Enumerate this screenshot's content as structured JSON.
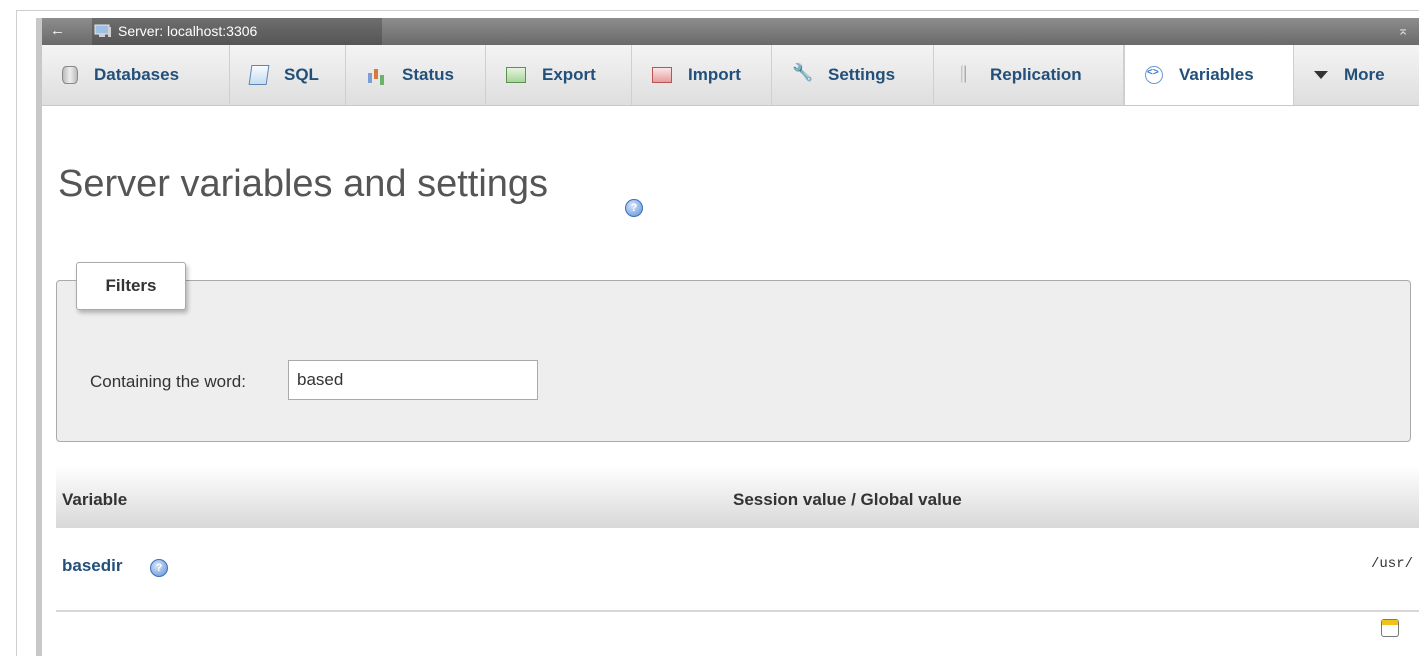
{
  "topbar": {
    "back_glyph": "←",
    "server_label": "Server: localhost:3306",
    "collapse_glyph": "⌅"
  },
  "tabs": [
    {
      "label": "Databases",
      "icon": "database-icon"
    },
    {
      "label": "SQL",
      "icon": "sql-icon"
    },
    {
      "label": "Status",
      "icon": "status-icon"
    },
    {
      "label": "Export",
      "icon": "export-icon"
    },
    {
      "label": "Import",
      "icon": "import-icon"
    },
    {
      "label": "Settings",
      "icon": "wrench-icon"
    },
    {
      "label": "Replication",
      "icon": "replication-icon"
    },
    {
      "label": "Variables",
      "icon": "variables-icon",
      "active": true
    },
    {
      "label": "More",
      "icon": "chevron-down-icon"
    }
  ],
  "page": {
    "title": "Server variables and settings",
    "help_glyph": "?"
  },
  "filters": {
    "legend": "Filters",
    "label": "Containing the word:",
    "value": "based"
  },
  "table": {
    "col_variable": "Variable",
    "col_value": "Session value / Global value",
    "rows": [
      {
        "name": "basedir",
        "value": "/usr/"
      }
    ]
  },
  "colors": {
    "link": "#23507a",
    "topbar": "#6a6a6a",
    "filter_bg": "#eeeeee"
  }
}
